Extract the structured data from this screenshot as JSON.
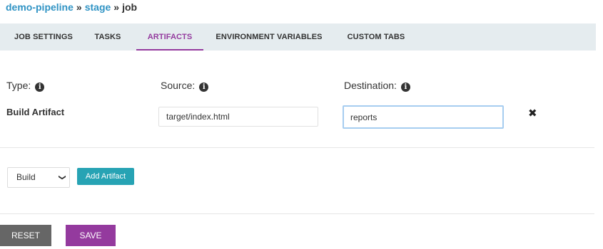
{
  "breadcrumb": {
    "pipeline": "demo-pipeline",
    "separator": "»",
    "stage": "stage",
    "job": "job"
  },
  "tabs": [
    {
      "label": "JOB SETTINGS",
      "active": false
    },
    {
      "label": "TASKS",
      "active": false
    },
    {
      "label": "ARTIFACTS",
      "active": true
    },
    {
      "label": "ENVIRONMENT VARIABLES",
      "active": false
    },
    {
      "label": "CUSTOM TABS",
      "active": false
    }
  ],
  "artifact_form": {
    "type_label": "Type:",
    "source_label": "Source:",
    "destination_label": "Destination:",
    "info_icon": "info-circle-icon",
    "artifacts": [
      {
        "type": "Build Artifact",
        "source": "target/index.html",
        "destination": "reports"
      }
    ],
    "remove_icon": "close-icon"
  },
  "add_artifact": {
    "selected_type": "Build",
    "button_label": "Add Artifact"
  },
  "footer": {
    "reset_label": "RESET",
    "save_label": "SAVE"
  },
  "colors": {
    "link": "#2f93c4",
    "tabbar_bg": "#e5ecef",
    "active_tab": "#943a9e",
    "add_button": "#27a3b4",
    "reset_button": "#666666",
    "save_button": "#943a9e"
  }
}
